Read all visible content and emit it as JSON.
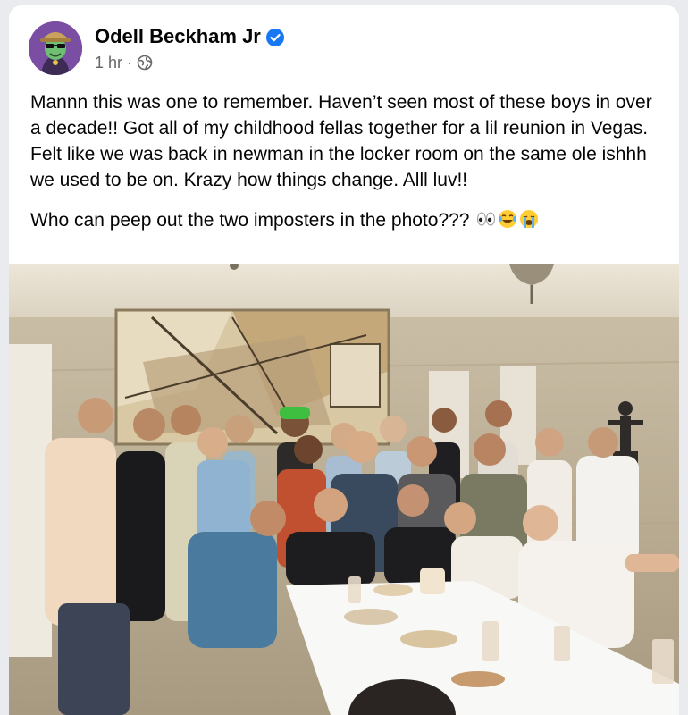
{
  "post": {
    "author_name": "Odell Beckham Jr",
    "timestamp": "1 hr",
    "separator": "·",
    "visibility_icon": "globe-icon",
    "verified_icon": "verified-badge-icon",
    "paragraph1": "Mannn this was one to remember. Haven’t seen most of these boys in over a decade!! Got all of my childhood fellas together for a lil reunion in Vegas. Felt like we was back in newman in the locker room on the same ole ishhh we used to be on. Krazy how things change. Alll luv!!",
    "paragraph2": "Who can peep out the two imposters in the photo???",
    "emojis": [
      "eyes-emoji",
      "tears-of-joy-emoji",
      "loudly-crying-emoji"
    ]
  },
  "colors": {
    "verified_blue": "#1877f2",
    "meta_gray": "#65676b",
    "text": "#050505",
    "avatar_bg": "#7a4fa3"
  }
}
